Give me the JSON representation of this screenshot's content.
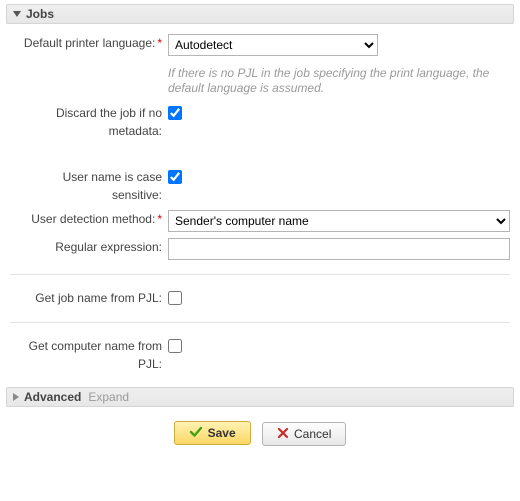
{
  "sections": {
    "jobs": {
      "title": "Jobs"
    },
    "advanced": {
      "title": "Advanced",
      "expand": "Expand"
    }
  },
  "fields": {
    "defaultPrinterLanguage": {
      "label": "Default printer language:",
      "value": "Autodetect",
      "help": "If there is no PJL in the job specifying the print language, the default language is assumed."
    },
    "discardNoMetadata": {
      "label": "Discard the job if no metadata:",
      "value": true
    },
    "userNameCaseSensitive": {
      "label": "User name is case sensitive:",
      "value": true
    },
    "userDetectionMethod": {
      "label": "User detection method:",
      "value": "Sender's computer name"
    },
    "regularExpression": {
      "label": "Regular expression:",
      "value": ""
    },
    "getJobNameFromPjl": {
      "label": "Get job name from PJL:",
      "value": false
    },
    "getComputerNameFromPjl": {
      "label": "Get computer name from PJL:",
      "value": false
    }
  },
  "buttons": {
    "save": "Save",
    "cancel": "Cancel"
  }
}
